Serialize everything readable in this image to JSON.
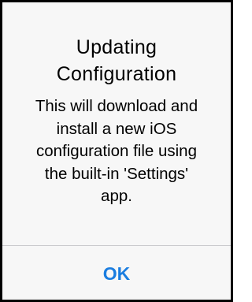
{
  "alert": {
    "title_line1": "Updating",
    "title_line2": "Configuration",
    "message_lines": [
      "This will download and",
      "install a new iOS",
      "configuration file using",
      "the built-in 'Settings'",
      "app."
    ],
    "ok_label": "OK",
    "accent_color": "#1a7de0",
    "background_color": "#f7f7f7"
  }
}
